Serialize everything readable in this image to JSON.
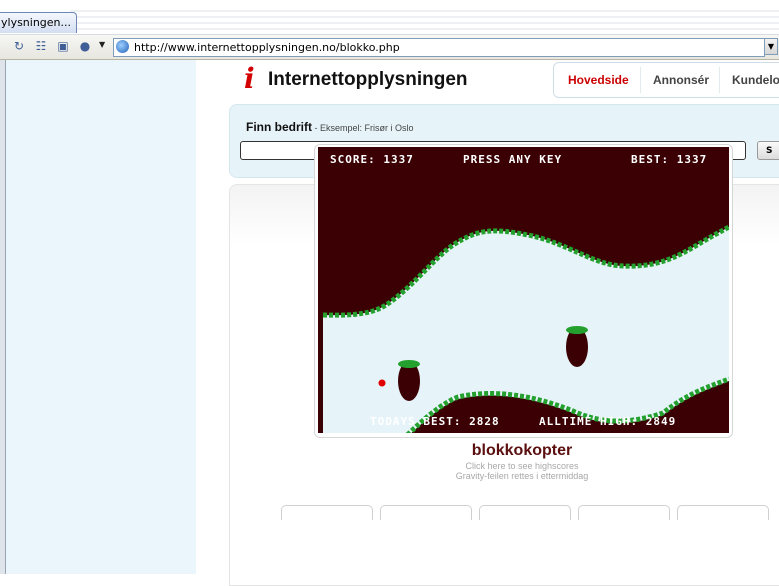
{
  "browser": {
    "tab_label": "ylysningen...",
    "url": "http://www.internettopplysningen.no/blokko.php",
    "toolbar_icons": [
      "refresh-icon",
      "page-icon",
      "print-icon",
      "globe-icon"
    ]
  },
  "site": {
    "logo_letter": "i",
    "logo_text": "Internettopplysningen",
    "nav": [
      "Hovedside",
      "Annonsér",
      "Kundelog"
    ],
    "nav_active_color": "#cc0000"
  },
  "search": {
    "title": "Finn bedrift",
    "hint": " - Eksempel: Frisør i Oslo",
    "input_value": "",
    "button_label": "S"
  },
  "game": {
    "score": "SCORE: 1337",
    "prompt": "PRESS ANY KEY",
    "best": "BEST: 1337",
    "todays_best": "TODAYS BEST: 2828",
    "alltime_high": "ALLTIME HIGH: 2849",
    "colors": {
      "wall": "#3b0003",
      "tunnel": "#e6f4f9",
      "grass": "#23a02d",
      "player": "#e00000"
    }
  },
  "game_info": {
    "title": "blokkokopter",
    "highscores_link": "Click here to see highscores",
    "notice": "Gravity-feilen rettes i ettermiddag"
  }
}
